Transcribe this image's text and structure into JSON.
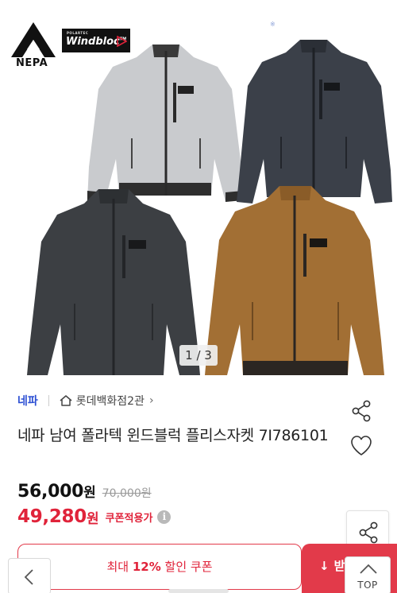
{
  "hero": {
    "brand_logo_text": "NEPA",
    "tech_logo_sub": "POLARTEC",
    "tech_logo_text": "Windbloc",
    "tech_logo_tm": "TM",
    "small_mark": "※",
    "pager": "1 / 3",
    "jacket_colors": {
      "light_grey": "#c9cbce",
      "navy": "#3b4049",
      "charcoal": "#3c3f43",
      "camel": "#a26f34"
    }
  },
  "breadcrumb": {
    "brand": "네파",
    "store": "롯데백화점2관",
    "chevron": "›"
  },
  "product": {
    "title": "네파 남여 폴라텍 윈드블럭 플리스자켓 7I786101"
  },
  "price": {
    "sale": "56,000",
    "unit": "원",
    "original": "70,000원"
  },
  "coupon": {
    "price": "49,280",
    "unit": "원",
    "note": "쿠폰적용가",
    "info_icon": "i"
  },
  "buttons": {
    "coupon_prefix": "최대 ",
    "coupon_highlight": "12%",
    "coupon_suffix": " 할인 쿠폰",
    "download_label": "받기",
    "download_arrow": "↓",
    "top_label": "TOP"
  },
  "colors": {
    "accent_red": "#e0233a",
    "brand_blue": "#2c4fd3"
  },
  "icons": [
    "share-icon",
    "heart-icon",
    "home-icon",
    "info-icon",
    "chevron-left-icon",
    "chevron-up-icon",
    "download-icon"
  ]
}
